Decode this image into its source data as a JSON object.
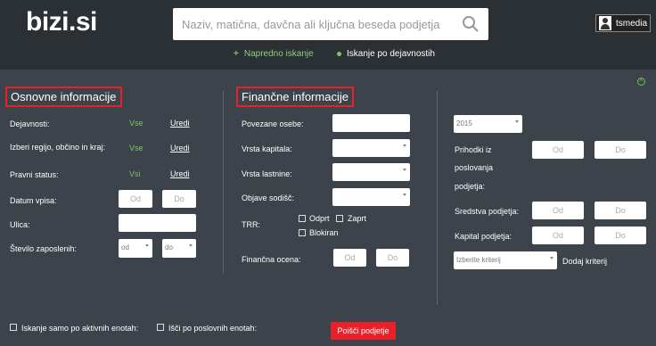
{
  "header": {
    "logo": "bizi.si",
    "search_placeholder": "Naziv, matična, davčna ali ključna beseda podjetja",
    "user_name": "tsmedia",
    "advanced_search": "Napredno iskanje",
    "activity_search": "Iskanje po dejavnostih"
  },
  "basic": {
    "title": "Osnovne informacije",
    "activity_label": "Dejavnosti:",
    "activity_value": "Vse",
    "activity_edit": "Uredi",
    "region_label": "Izberi regijo, občino in kraj:",
    "region_value": "Vse",
    "region_edit": "Uredi",
    "legal_label": "Pravni status:",
    "legal_value": "Vsi",
    "legal_edit": "Uredi",
    "entry_date_label": "Datum vpisa:",
    "entry_from": "Od",
    "entry_to": "Do",
    "street_label": "Ulica:",
    "employees_label": "Število zaposlenih:",
    "employees_from": "od",
    "employees_to": "do"
  },
  "financial": {
    "title": "Finančne informacije",
    "related_label": "Povezane osebe:",
    "capital_type_label": "Vrsta kapitala:",
    "ownership_label": "Vrsta lastnine:",
    "court_label": "Objave sodišč:",
    "trr_label": "TRR:",
    "trr_open": "Odprt",
    "trr_closed": "Zaprt",
    "trr_blocked": "Blokiran",
    "rating_label": "Finančna ocena:",
    "rating_from": "Od",
    "rating_to": "Do"
  },
  "right": {
    "year": "2015",
    "revenue_label_1": "Prihodki iz",
    "revenue_label_2": "poslovanja",
    "revenue_label_3": "podjetja:",
    "revenue_from": "Od",
    "revenue_to": "Do",
    "assets_label": "Sredstva podjetja:",
    "assets_from": "Od",
    "assets_to": "Do",
    "capital_label": "Kapital podjetja:",
    "capital_from": "Od",
    "capital_to": "Do",
    "criteria_placeholder": "Izberite kriterij",
    "add_criteria": "Dodaj kriterij"
  },
  "footer": {
    "active_only": "Iskanje samo po aktivnih enotah:",
    "business_units": "Išči po poslovnih enotah:",
    "search_button": "Poišči podjetje"
  },
  "colors": {
    "accent_green": "#7ec36a",
    "accent_red": "#e8202a",
    "background": "#3d434a",
    "header_bg": "#2b3035"
  }
}
